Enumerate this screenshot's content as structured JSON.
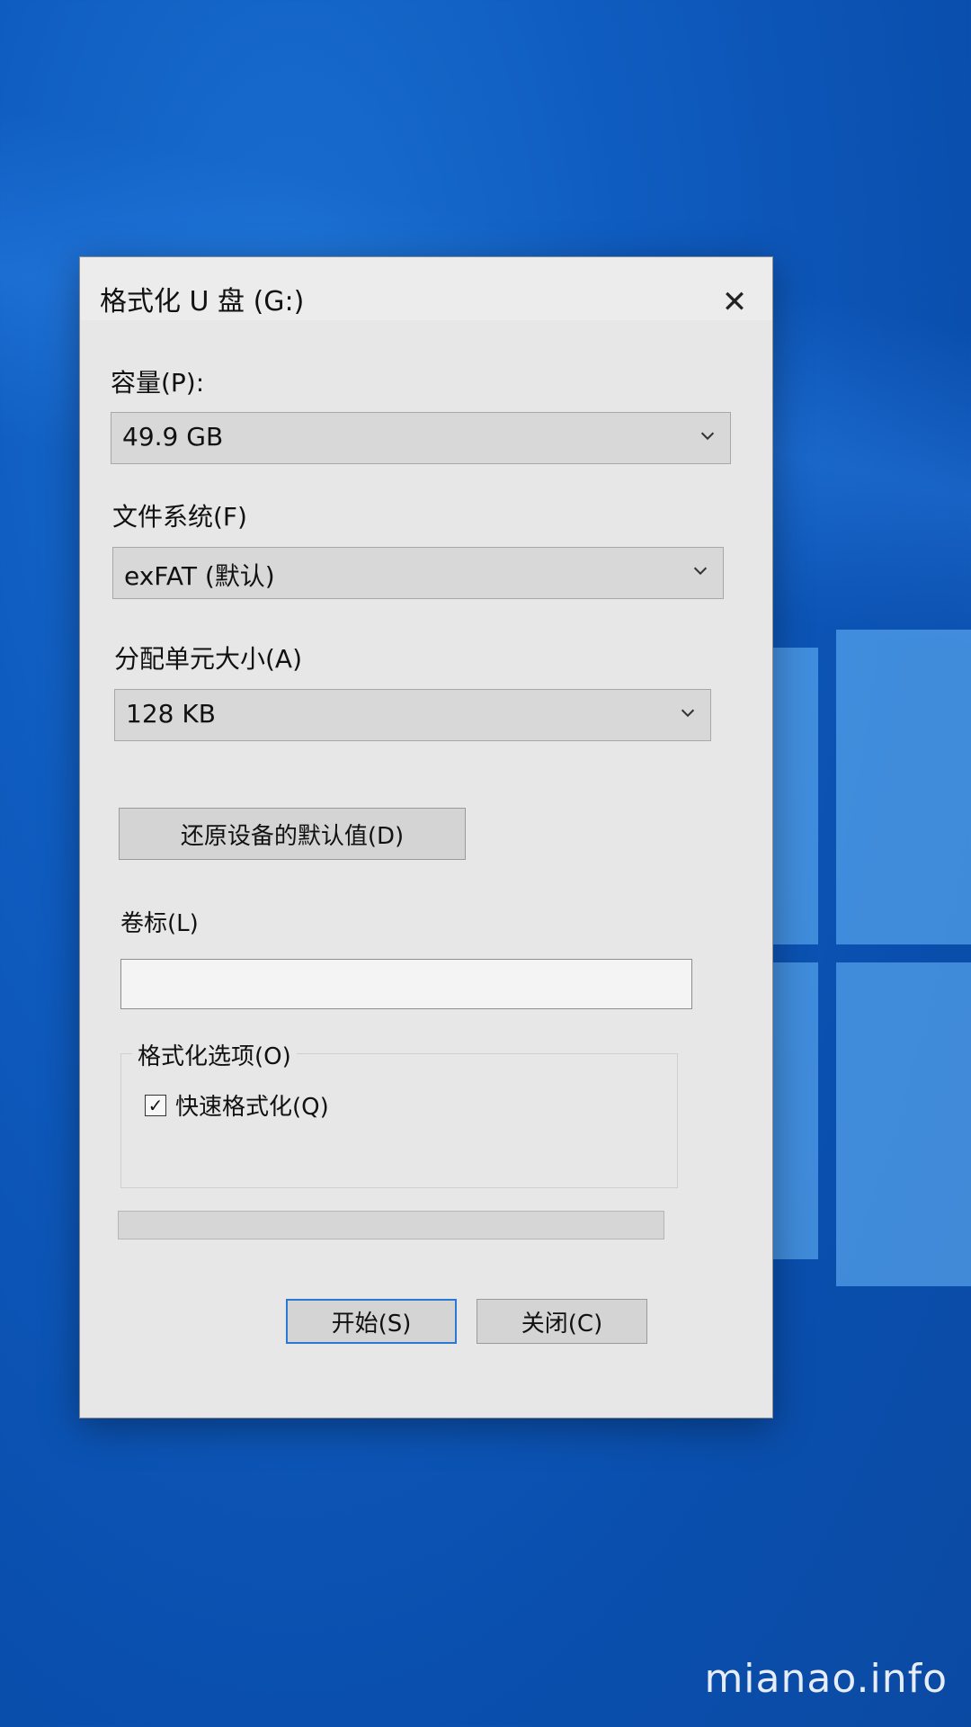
{
  "dialog": {
    "title": "格式化 U 盘 (G:)",
    "close_icon": "close-icon"
  },
  "capacity": {
    "label": "容量(P):",
    "value": "49.9 GB"
  },
  "filesystem": {
    "label": "文件系统(F)",
    "value": "exFAT (默认)"
  },
  "allocation": {
    "label": "分配单元大小(A)",
    "value": "128 KB"
  },
  "restore_defaults_button": "还原设备的默认值(D)",
  "volume_label": {
    "label": "卷标(L)",
    "value": ""
  },
  "format_options": {
    "group_title": "格式化选项(O)",
    "quick_format": {
      "label": "快速格式化(Q)",
      "checked": true
    }
  },
  "progress": {
    "value_percent": 0
  },
  "buttons": {
    "start": "开始(S)",
    "close": "关闭(C)"
  },
  "watermark": "mianao.info",
  "colors": {
    "desktop_blue": "#0f5cc0",
    "focus_border": "#2a78d6"
  }
}
